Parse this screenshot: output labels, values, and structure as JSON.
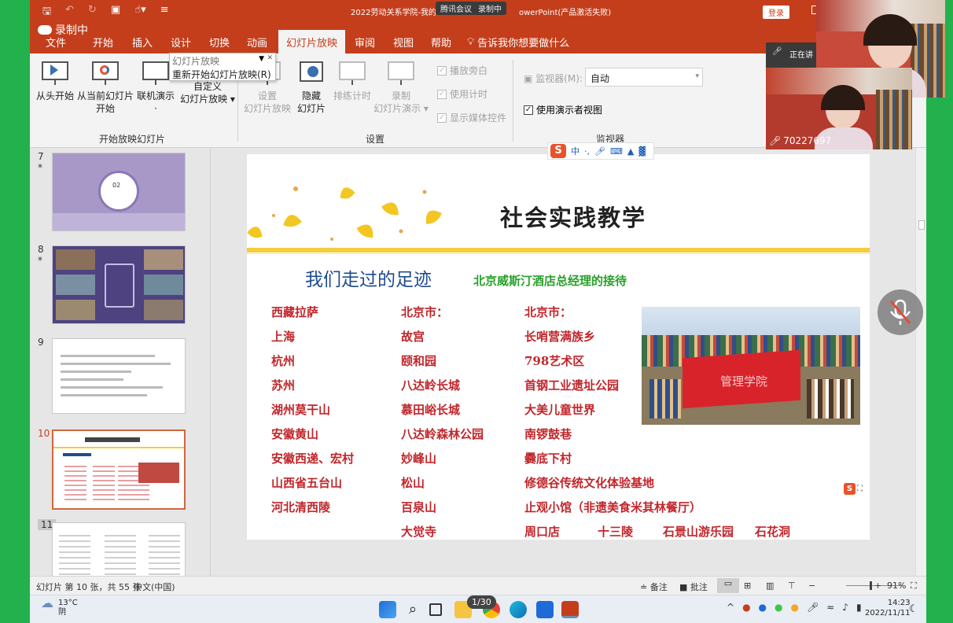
{
  "window": {
    "title": "2022劳动关系学院-我的幻灯片 - PowerPoint(产品激活失败)",
    "title_left": "2022劳动关系学院-我的",
    "title_right": "owerPoint(产品激活失败)",
    "meeting_label": "腾讯会议",
    "recording_status": "录制中",
    "login_button": "登录"
  },
  "recording_badge": "录制中",
  "tabs": [
    {
      "label": "文件"
    },
    {
      "label": "开始"
    },
    {
      "label": "插入"
    },
    {
      "label": "设计"
    },
    {
      "label": "切换"
    },
    {
      "label": "动画"
    },
    {
      "label": "幻灯片放映",
      "active": true
    },
    {
      "label": "审阅"
    },
    {
      "label": "视图"
    },
    {
      "label": "帮助"
    }
  ],
  "tell_me": "告诉我你想要做什么",
  "ribbon": {
    "from_start": "从头开始",
    "from_current_l1": "从当前幻灯片",
    "from_current_l2": "开始",
    "present_online_l1": "联机演示",
    "present_online_l2": "·",
    "custom_show_l1": "自定义",
    "custom_show_l2": "幻灯片放映",
    "group_start": "开始放映幻灯片",
    "setup_show_l1": "设置",
    "setup_show_l2": "幻灯片放映",
    "hide_slide_l1": "隐藏",
    "hide_slide_l2": "幻灯片",
    "rehearse": "排练计时",
    "record_l1": "录制",
    "record_l2": "幻灯片演示",
    "play_narrations": "播放旁白",
    "use_timings": "使用计时",
    "show_media_controls": "显示媒体控件",
    "group_setup": "设置",
    "monitor_label": "监视器(M):",
    "monitor_value": "自动",
    "presenter_view": "使用演示者视图",
    "group_monitor": "监视器"
  },
  "dropdown": {
    "item1": "幻灯片放映",
    "item2": "重新开始幻灯片放映(R)"
  },
  "thumbnails": [
    {
      "num": "7",
      "mark": "*"
    },
    {
      "num": "8",
      "mark": "*"
    },
    {
      "num": "9",
      "mark": ""
    },
    {
      "num": "10",
      "mark": ""
    },
    {
      "num": "11",
      "mark": ""
    }
  ],
  "thumb7_text": "02",
  "slide": {
    "title": "社会实践教学",
    "subtitle": "我们走过的足迹",
    "hotel_caption": "北京威斯汀酒店总经理的接待",
    "col1": [
      "西藏拉萨",
      "上海",
      "杭州",
      "苏州",
      "湖州莫干山",
      "安徽黄山",
      "安徽西递、宏村",
      "山西省五台山",
      "河北清西陵"
    ],
    "col2": [
      "北京市：",
      "故宫",
      "颐和园",
      "八达岭长城",
      "慕田峪长城",
      "八达岭森林公园",
      "妙峰山",
      "松山",
      "百泉山",
      "大觉寺"
    ],
    "col3": [
      "北京市：",
      "长哨营满族乡",
      "798艺术区",
      "首钢工业遗址公园",
      "大美儿童世界",
      "南锣鼓巷",
      "爨底下村",
      "修德谷传统文化体验基地",
      "止观小馆（非遗美食米其林餐厅）"
    ],
    "last_row": [
      "周口店",
      "十三陵",
      "石景山游乐园",
      "石花洞"
    ],
    "banner_text": "管理学院"
  },
  "video": {
    "tile1_name": "70227697",
    "tile2_name": "70227697",
    "tile2_status": "正在讲"
  },
  "statusbar": {
    "slide_info": "幻灯片 第 10 张，共 55 张",
    "language": "中文(中国)",
    "notes": "备注",
    "comments": "批注",
    "zoom": "91%"
  },
  "taskbar": {
    "temp": "13°C",
    "weather": "阴",
    "pager": "1/30",
    "time": "14:23",
    "date": "2022/11/11"
  },
  "colors": {
    "ppt_accent": "#c43e1c",
    "share_frame": "#22b14c",
    "place_text": "#c0262b",
    "subtitle": "#1f4b8f",
    "hotel_caption": "#2aa02a",
    "gold_rule": "#f3cd3c"
  }
}
